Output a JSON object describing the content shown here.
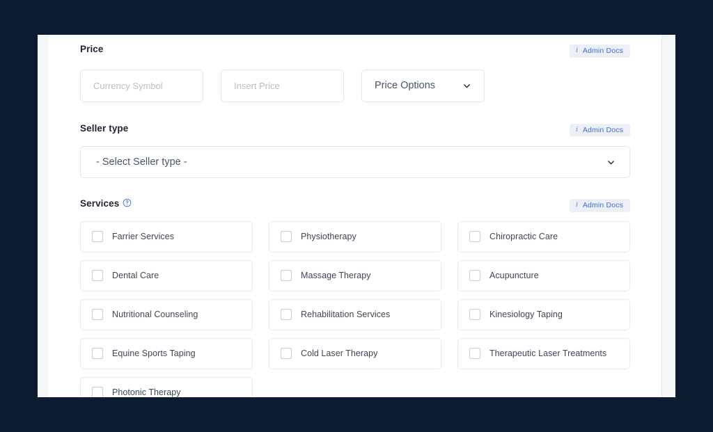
{
  "theme": {
    "page_background": "#0b1c31",
    "panel_background": "#ffffff",
    "panel_rail": "#f5f6f8",
    "accent_blue": "#3d6fd0",
    "badge_background": "#eceff5",
    "border": "#e4e7eb",
    "label_color": "#1d2430",
    "placeholder_color": "#b9bec9"
  },
  "price": {
    "label": "Price",
    "admin_docs": {
      "icon": "info-icon",
      "label": "Admin Docs"
    },
    "currency_placeholder": "Currency Symbol",
    "currency_value": "",
    "amount_placeholder": "Insert Price",
    "amount_value": "",
    "options_selected": "Price Options",
    "options_chevron": "chevron-down-icon"
  },
  "seller_type": {
    "label": "Seller type",
    "admin_docs": {
      "icon": "info-icon",
      "label": "Admin Docs"
    },
    "selected": "- Select Seller type -",
    "chevron": "chevron-down-icon"
  },
  "services": {
    "label": "Services",
    "help_icon": "question-circle-icon",
    "admin_docs": {
      "icon": "info-icon",
      "label": "Admin Docs"
    },
    "items": [
      {
        "label": "Farrier Services",
        "checked": false
      },
      {
        "label": "Physiotherapy",
        "checked": false
      },
      {
        "label": "Chiropractic Care",
        "checked": false
      },
      {
        "label": "Dental Care",
        "checked": false
      },
      {
        "label": "Massage Therapy",
        "checked": false
      },
      {
        "label": "Acupuncture",
        "checked": false
      },
      {
        "label": "Nutritional Counseling",
        "checked": false
      },
      {
        "label": "Rehabilitation Services",
        "checked": false
      },
      {
        "label": "Kinesiology Taping",
        "checked": false
      },
      {
        "label": "Equine Sports Taping",
        "checked": false
      },
      {
        "label": "Cold Laser Therapy",
        "checked": false
      },
      {
        "label": "Therapeutic Laser Treatments",
        "checked": false
      },
      {
        "label": "Photonic Therapy",
        "checked": false
      }
    ]
  }
}
